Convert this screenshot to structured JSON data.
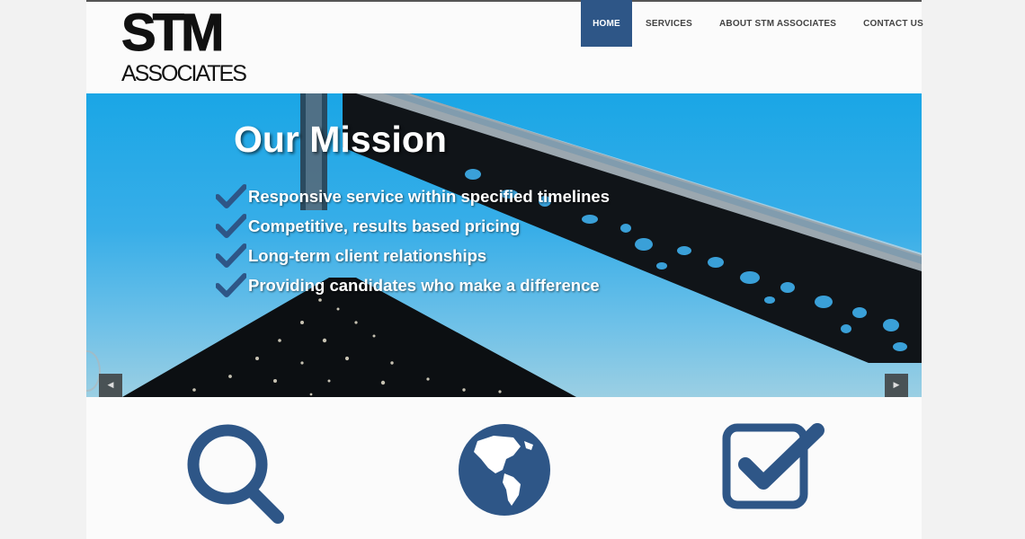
{
  "logo": {
    "top_text": "STM",
    "bottom_text": "ASSOCIATES"
  },
  "nav": {
    "items": [
      {
        "label": "HOME",
        "active": true
      },
      {
        "label": "SERVICES",
        "active": false
      },
      {
        "label": "ABOUT STM ASSOCIATES",
        "active": false
      },
      {
        "label": "CONTACT US",
        "active": false
      }
    ]
  },
  "hero": {
    "title": "Our Mission",
    "items": [
      "Responsive service within specified timelines",
      "Competitive, results based pricing",
      "Long-term client relationships",
      "Providing candidates who make a difference"
    ],
    "prev_icon": "chevron-left-icon",
    "next_icon": "chevron-right-icon"
  },
  "features": {
    "icons": [
      "search-icon",
      "globe-icon",
      "checkbox-icon"
    ]
  },
  "colors": {
    "brand_blue": "#2e5687",
    "sky": "#1aa6e6",
    "page_bg": "#fbfbfb"
  }
}
